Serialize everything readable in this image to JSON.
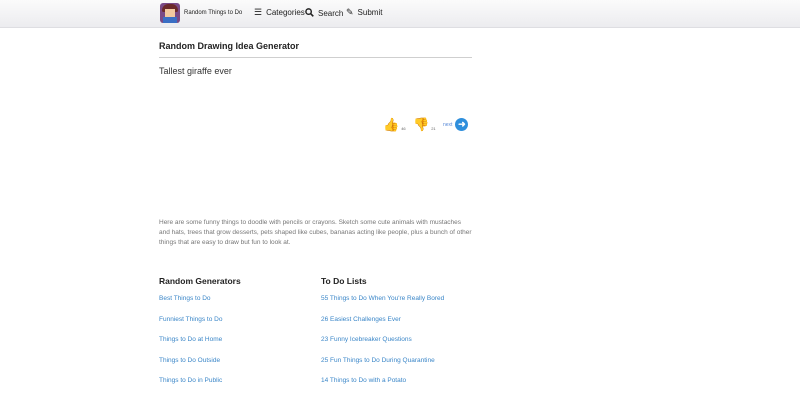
{
  "header": {
    "site_title": "Random Things to Do",
    "nav": [
      {
        "label": "Categories",
        "icon": "menu-icon"
      },
      {
        "label": "Search",
        "icon": "search-icon"
      },
      {
        "label": "Submit",
        "icon": "pencil-icon"
      }
    ]
  },
  "generator": {
    "title": "Random Drawing Idea Generator",
    "idea": "Tallest giraffe ever",
    "upvotes": "46",
    "downvotes": "21",
    "next_label": "next"
  },
  "description": "Here are some funny things to doodle with pencils or crayons. Sketch some cute animals with mustaches and hats, trees that grow desserts, pets shaped like cubes, bananas acting like people, plus a bunch of other things that are easy to draw but fun to look at.",
  "sections": {
    "random_generators": {
      "title": "Random Generators",
      "links": [
        "Best Things to Do",
        "Funniest Things to Do",
        "Things to Do at Home",
        "Things to Do Outside",
        "Things to Do in Public"
      ]
    },
    "todo_lists": {
      "title": "To Do Lists",
      "links": [
        "55 Things to Do When You're Really Bored",
        "26 Easiest Challenges Ever",
        "23 Funny Icebreaker Questions",
        "25 Fun Things to Do During Quarantine",
        "14 Things to Do with a Potato"
      ]
    }
  },
  "colors": {
    "accent_link": "#3a86c8",
    "thumb_up": "#6aa532",
    "thumb_down": "#d9641f",
    "next_button": "#2f8fdc"
  }
}
